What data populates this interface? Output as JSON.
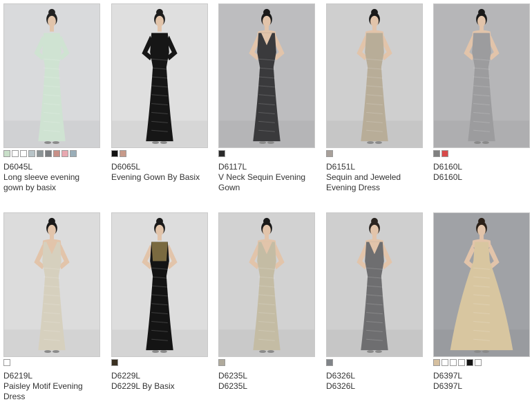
{
  "products": [
    {
      "code": "D6045L",
      "title": "Long sleeve evening gown by basix",
      "bg": "#d9dadc",
      "dress": "#cfe3d2",
      "hair": "#222222",
      "style": "sleeve",
      "swatches": [
        "#c9dfc9",
        "#ffffff",
        "#ffffff",
        "#b8c4c8",
        "#8c9496",
        "#7a7d80",
        "#c89088",
        "#e8a8b0",
        "#9aaeb8"
      ]
    },
    {
      "code": "D6065L",
      "title": "Evening Gown By Basix",
      "bg": "#dfdfdf",
      "dress": "#161616",
      "hair": "#1c1c1c",
      "style": "sleeve",
      "swatches": [
        "#111111",
        "#c79a8a"
      ]
    },
    {
      "code": "D6117L",
      "title": "V Neck Sequin Evening Gown",
      "bg": "#bdbdbf",
      "dress": "#3a3a3c",
      "hair": "#1a1a1a",
      "style": "vneck",
      "swatches": [
        "#2a2a2a"
      ]
    },
    {
      "code": "D6151L",
      "title": "Sequin and Jeweled Evening Dress",
      "bg": "#cfcfcf",
      "dress": "#b8ad98",
      "hair": "#1a1a1a",
      "style": "strapless",
      "swatches": [
        "#a8a09a"
      ]
    },
    {
      "code": "D6160L",
      "title": "D6160L",
      "bg": "#b6b6b8",
      "dress": "#9c9c9e",
      "hair": "#1a1a1a",
      "style": "strapless",
      "swatches": [
        "#808080",
        "#d84a4a"
      ]
    },
    {
      "code": "D6219L",
      "title": "Paisley Motif Evening Dress",
      "bg": "#dcdcdc",
      "dress": "#d6d0be",
      "hair": "#1a1a1a",
      "style": "vneck",
      "swatches": [
        "#ffffff"
      ]
    },
    {
      "code": "D6229L",
      "title": "D6229L By Basix",
      "bg": "#dddddd",
      "dress": "#141414",
      "hair": "#1a1a1a",
      "style": "cap",
      "swatches": [
        "#3a3020"
      ]
    },
    {
      "code": "D6235L",
      "title": "D6235L",
      "bg": "#d2d2d2",
      "dress": "#c4bca4",
      "hair": "#1a1a1a",
      "style": "vneck",
      "swatches": [
        "#b0aa9c"
      ]
    },
    {
      "code": "D6326L",
      "title": "D6326L",
      "bg": "#cfcfcf",
      "dress": "#6e6e70",
      "hair": "#2a2420",
      "style": "vneck",
      "swatches": [
        "#808488"
      ]
    },
    {
      "code": "D6397L",
      "title": "D6397L",
      "bg": "#a0a2a6",
      "dress": "#d8c6a0",
      "hair": "#2a2018",
      "style": "ballgown",
      "swatches": [
        "#d6c0a0",
        "#ffffff",
        "#ffffff",
        "#ffffff",
        "#151515",
        "#ffffff"
      ]
    }
  ]
}
